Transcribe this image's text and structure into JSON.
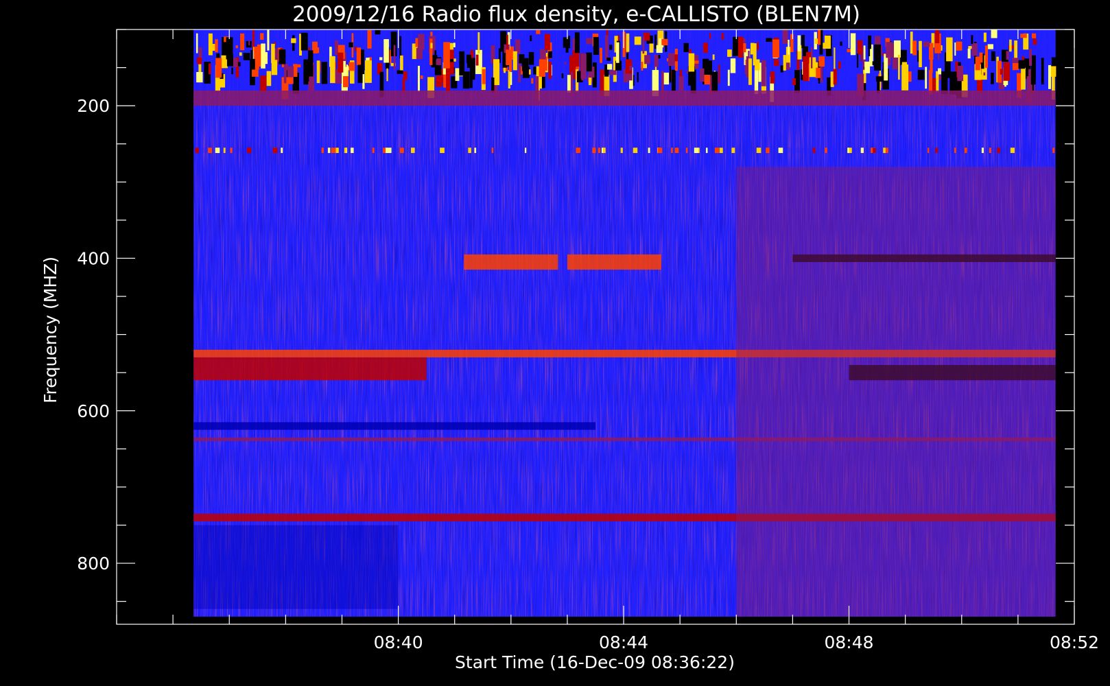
{
  "chart_data": {
    "type": "heatmap",
    "title": "2009/12/16  Radio flux density, e-CALLISTO (BLEN7M)",
    "xlabel": "Start Time (16-Dec-09 08:36:22)",
    "ylabel": "Frequency (MHZ)",
    "x_axis": {
      "type": "time",
      "range": [
        "08:35:00",
        "08:52:00"
      ],
      "major_ticks": [
        "08:40",
        "08:44",
        "08:48",
        "08:52"
      ],
      "minor_tick_interval_min": 1
    },
    "y_axis": {
      "range": [
        100,
        880
      ],
      "inverted": true,
      "major_ticks": [
        200,
        400,
        600,
        800
      ],
      "minor_tick_interval": 50
    },
    "data_extent": {
      "time": [
        "08:36:22",
        "08:51:40"
      ],
      "frequency_mhz": [
        100,
        870
      ]
    },
    "colormap": [
      "#000000",
      "#0000b4",
      "#2020ff",
      "#8a1a6a",
      "#c00000",
      "#ff4000",
      "#ffd000",
      "#ffff80"
    ],
    "features": [
      {
        "kind": "band",
        "freq_mhz": [
          100,
          180
        ],
        "time": [
          "08:36:22",
          "08:51:40"
        ],
        "level": 0.85,
        "noise": "high"
      },
      {
        "kind": "band",
        "freq_mhz": [
          180,
          200
        ],
        "time": [
          "08:36:22",
          "08:51:40"
        ],
        "level": 0.4
      },
      {
        "kind": "band",
        "freq_mhz": [
          255,
          262
        ],
        "time": [
          "08:36:22",
          "08:51:40"
        ],
        "level": 0.9,
        "pattern": "intermittent"
      },
      {
        "kind": "band",
        "freq_mhz": [
          395,
          415
        ],
        "time": [
          "08:41:10",
          "08:42:50"
        ],
        "level": 0.75
      },
      {
        "kind": "band",
        "freq_mhz": [
          395,
          415
        ],
        "time": [
          "08:43:00",
          "08:44:40"
        ],
        "level": 0.75
      },
      {
        "kind": "band",
        "freq_mhz": [
          395,
          405
        ],
        "time": [
          "08:47:00",
          "08:51:40"
        ],
        "level": 0.05
      },
      {
        "kind": "band",
        "freq_mhz": [
          520,
          530
        ],
        "time": [
          "08:36:22",
          "08:51:40"
        ],
        "level": 0.7
      },
      {
        "kind": "band",
        "freq_mhz": [
          530,
          560
        ],
        "time": [
          "08:36:22",
          "08:40:30"
        ],
        "level": 0.5
      },
      {
        "kind": "band",
        "freq_mhz": [
          540,
          560
        ],
        "time": [
          "08:48:00",
          "08:51:40"
        ],
        "level": 0.05
      },
      {
        "kind": "band",
        "freq_mhz": [
          615,
          625
        ],
        "time": [
          "08:36:22",
          "08:43:30"
        ],
        "level": 0.08
      },
      {
        "kind": "band",
        "freq_mhz": [
          635,
          640
        ],
        "time": [
          "08:36:22",
          "08:51:40"
        ],
        "level": 0.45
      },
      {
        "kind": "band",
        "freq_mhz": [
          735,
          745
        ],
        "time": [
          "08:36:22",
          "08:51:40"
        ],
        "level": 0.5
      },
      {
        "kind": "region",
        "freq_mhz": [
          280,
          870
        ],
        "time": [
          "08:46:00",
          "08:51:40"
        ],
        "level": 0.45
      },
      {
        "kind": "region",
        "freq_mhz": [
          750,
          860
        ],
        "time": [
          "08:36:22",
          "08:40:00"
        ],
        "level": 0.15
      }
    ]
  }
}
